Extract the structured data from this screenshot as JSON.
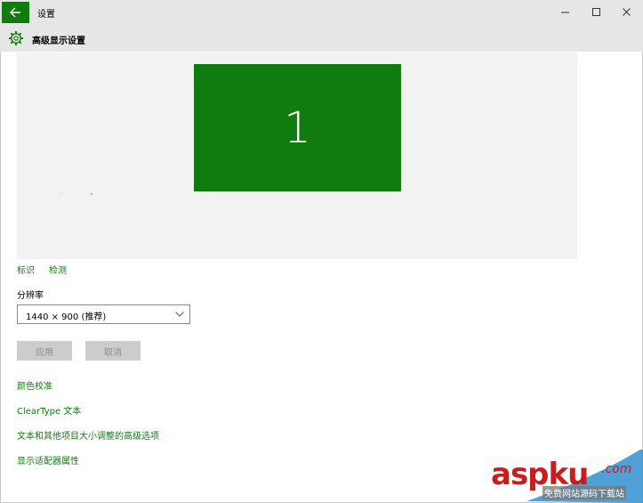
{
  "window": {
    "app_title": "设置",
    "page_title": "高级显示设置",
    "controls": [
      "minimize-icon",
      "maximize-icon",
      "close-icon"
    ]
  },
  "preview": {
    "monitor_number": "1",
    "monitor_color": "#107c10"
  },
  "links": {
    "identify": "标识",
    "detect": "检测",
    "color_calibration": "颜色校准",
    "cleartype": "ClearType 文本",
    "advanced_sizing": "文本和其他项目大小调整的高级选项",
    "adapter_properties": "显示适配器属性"
  },
  "resolution": {
    "label": "分辨率",
    "selected": "1440 × 900 (推荐)"
  },
  "buttons": {
    "apply": "应用",
    "cancel": "取消"
  },
  "watermark": {
    "logo": "aspku",
    "suffix": ".com",
    "subtitle": "免费网站源码下载站"
  },
  "colors": {
    "accent": "#107c10",
    "titlebar": "#e6e6e6",
    "preview_bg": "#f2f2f2",
    "disabled_button": "#cccccc"
  }
}
